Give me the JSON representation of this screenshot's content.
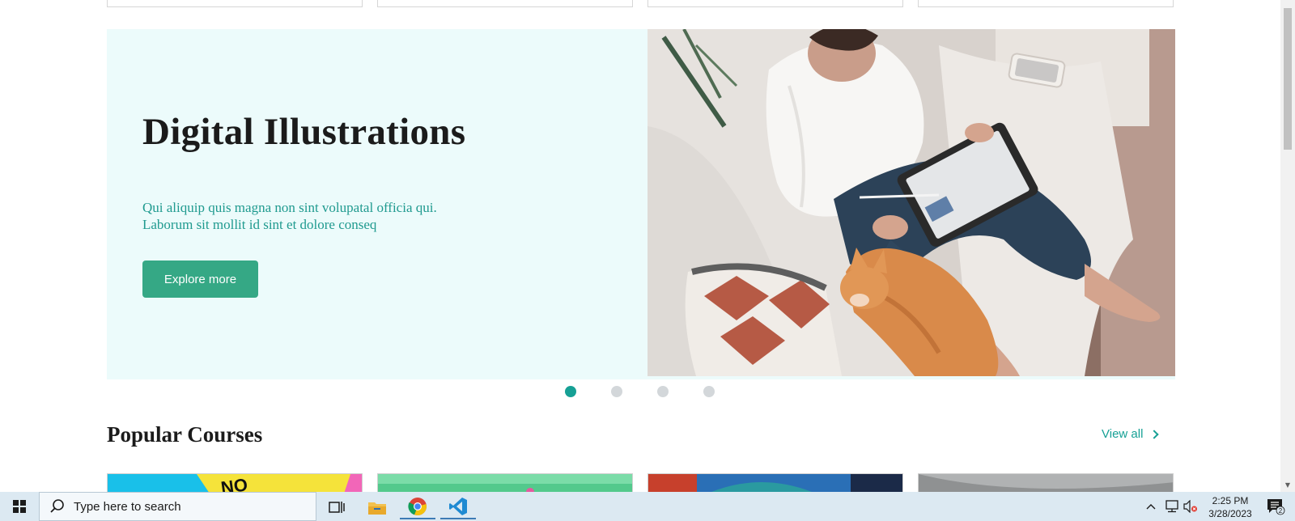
{
  "hero": {
    "title": "Digital Illustrations",
    "description_line1": "Qui aliquip quis magna non sint volupatal officia qui.",
    "description_line2": "Laborum sit mollit id sint et dolore conseq",
    "button_label": "Explore more",
    "background_color": "#ecfbfb",
    "button_color": "#35a885"
  },
  "carousel": {
    "slide_count": 4,
    "active_index": 0,
    "active_color": "#16a095",
    "inactive_color": "#d3d7da"
  },
  "popular": {
    "title": "Popular Courses",
    "view_all_label": "View all",
    "accent_color": "#16a095"
  },
  "taskbar": {
    "search_placeholder": "Type here to search",
    "time": "2:25 PM",
    "date": "3/28/2023",
    "notification_count": "2",
    "icons": [
      "windows-start-icon",
      "search-icon",
      "task-view-icon",
      "file-explorer-icon",
      "chrome-icon",
      "vscode-icon"
    ],
    "tray_icons": [
      "chevron-up-icon",
      "network-icon",
      "volume-muted-icon",
      "notification-icon"
    ]
  }
}
